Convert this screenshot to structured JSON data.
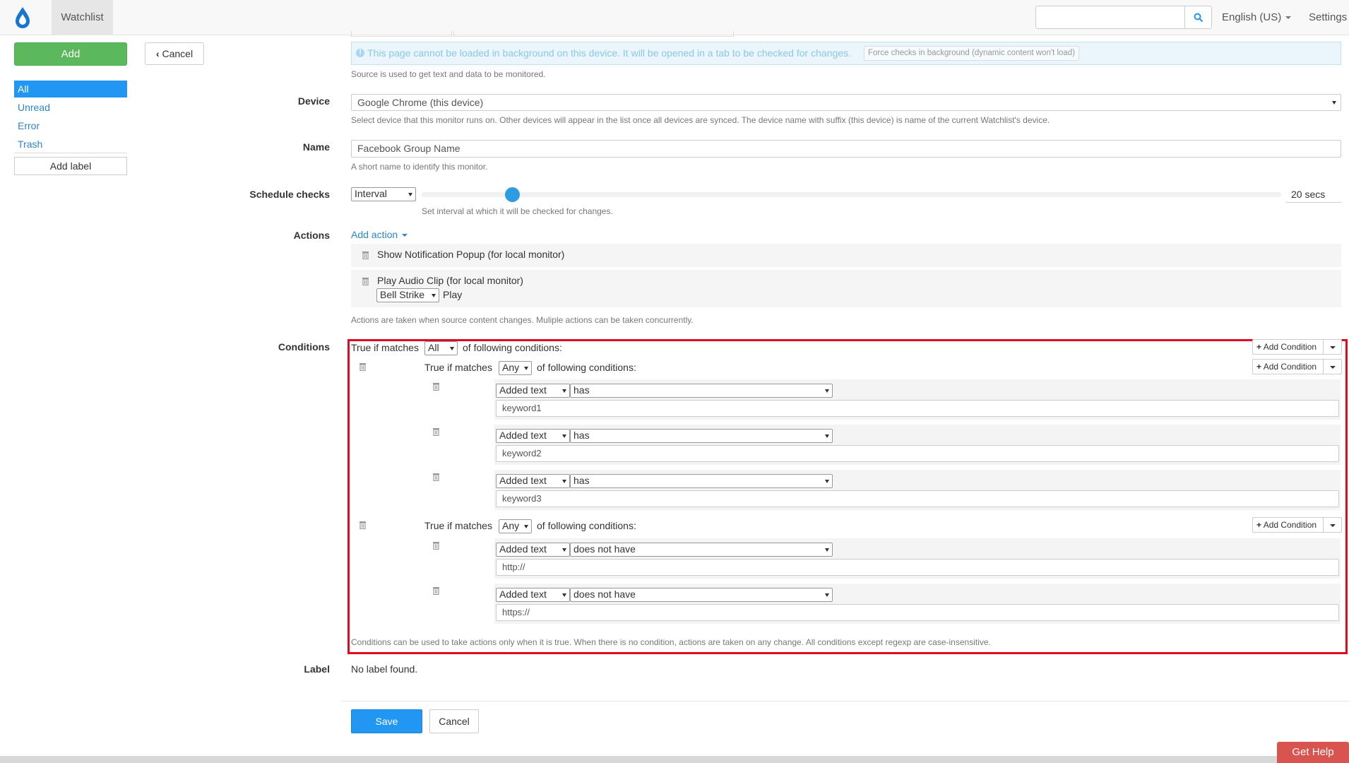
{
  "app": {
    "nav_tab": "Watchlist",
    "language": "English (US)",
    "settings": "Settings",
    "get_help": "Get Help"
  },
  "sidebar": {
    "add": "Add",
    "cancel": "Cancel",
    "items": [
      "All",
      "Unread",
      "Error",
      "Trash"
    ],
    "add_label": "Add label"
  },
  "source": {
    "background_note": "This page cannot be loaded in background on this device. It will be opened in a tab to be checked for changes.",
    "force_button": "Force checks in background (dynamic content won't load)",
    "help": "Source is used to get text and data to be monitored."
  },
  "device": {
    "label": "Device",
    "value": "Google Chrome (this device)",
    "help": "Select device that this monitor runs on. Other devices will appear in the list once all devices are synced. The device name with suffix (this device) is name of the current Watchlist's device."
  },
  "name": {
    "label": "Name",
    "value": "Facebook Group Name",
    "help": "A short name to identify this monitor."
  },
  "schedule": {
    "label": "Schedule checks",
    "mode": "Interval",
    "interval_value": "20 secs",
    "help": "Set interval at which it will be checked for changes."
  },
  "actions": {
    "label": "Actions",
    "add_action": "Add action",
    "items": [
      {
        "title": "Show Notification Popup (for local monitor)"
      },
      {
        "title": "Play Audio Clip (for local monitor)",
        "sound": "Bell Strike",
        "play": "Play"
      }
    ],
    "help": "Actions are taken when source content changes. Muliple actions can be taken concurrently."
  },
  "conditions": {
    "label": "Conditions",
    "true_if_matches": "True if matches",
    "of_following": "of following conditions:",
    "add_condition": "Add Condition",
    "root_match": "All",
    "groups": [
      {
        "match": "Any",
        "rules": [
          {
            "field": "Added text",
            "op": "has",
            "value": "keyword1"
          },
          {
            "field": "Added text",
            "op": "has",
            "value": "keyword2"
          },
          {
            "field": "Added text",
            "op": "has",
            "value": "keyword3"
          }
        ]
      },
      {
        "match": "Any",
        "rules": [
          {
            "field": "Added text",
            "op": "does not have",
            "value": "http://"
          },
          {
            "field": "Added text",
            "op": "does not have",
            "value": "https://"
          }
        ]
      }
    ],
    "help": "Conditions can be used to take actions only when it is true. When there is no condition, actions are taken on any change. All conditions except regexp are case-insensitive."
  },
  "label_section": {
    "label": "Label",
    "value": "No label found."
  },
  "footer": {
    "save": "Save",
    "cancel": "Cancel"
  },
  "colors": {
    "primary": "#2196f3",
    "add_green": "#5cb85c",
    "highlight_red": "#e00b1e",
    "help_red": "#d9534f"
  }
}
